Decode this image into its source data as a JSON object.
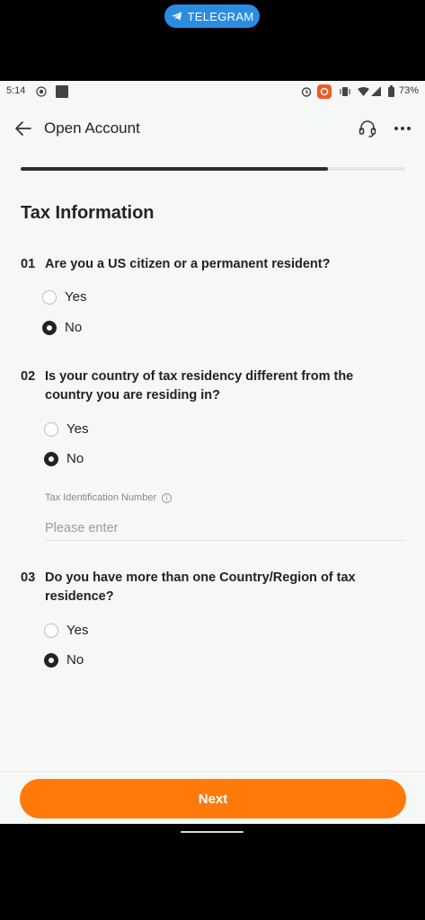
{
  "overlay": {
    "telegram_label": "TELEGRAM"
  },
  "status_bar": {
    "time": "5:14",
    "battery": "73%",
    "icons": [
      "record-icon",
      "square-icon",
      "alarm-icon",
      "app-notification-icon",
      "vibrate-icon",
      "wifi-icon",
      "signal-icon",
      "battery-icon"
    ]
  },
  "header": {
    "title": "Open Account",
    "icons": [
      "back-arrow-icon",
      "headset-icon",
      "more-icon"
    ]
  },
  "progress": {
    "value": 0.8
  },
  "section_title": "Tax Information",
  "questions": [
    {
      "number": "01",
      "text": "Are you a US citizen or a permanent resident?",
      "options": [
        "Yes",
        "No"
      ],
      "selected": "No"
    },
    {
      "number": "02",
      "text": "Is your country of tax residency different from the country you are residing in?",
      "options": [
        "Yes",
        "No"
      ],
      "selected": "No"
    },
    {
      "number": "03",
      "text": "Do you have more than one Country/Region of tax residence?",
      "options": [
        "Yes",
        "No"
      ],
      "selected": "No"
    }
  ],
  "tin": {
    "label": "Tax Identification Number",
    "placeholder": "Please enter",
    "value": ""
  },
  "footer": {
    "next_label": "Next"
  },
  "colors": {
    "accent": "#ff7a0a",
    "telegram": "#2a8de3",
    "background": "#f6f8f5",
    "progress": "#2b2f33"
  }
}
